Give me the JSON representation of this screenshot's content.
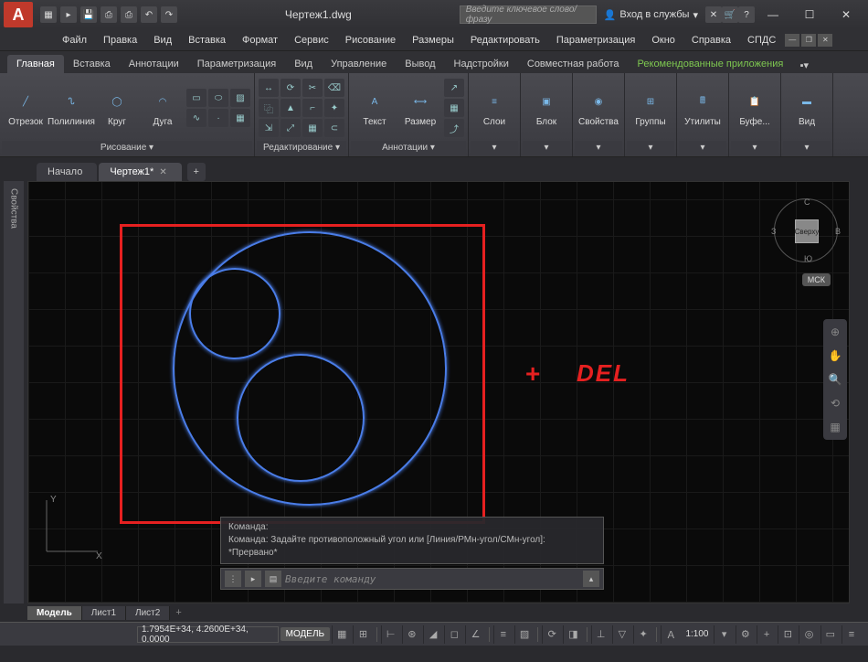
{
  "app": {
    "title": "Чертеж1.dwg",
    "logo": "A"
  },
  "search": {
    "placeholder": "Введите ключевое слово/фразу"
  },
  "signin": {
    "label": "Вход в службы"
  },
  "menu": [
    "Файл",
    "Правка",
    "Вид",
    "Вставка",
    "Формат",
    "Сервис",
    "Рисование",
    "Размеры",
    "Редактировать",
    "Параметризация",
    "Окно",
    "Справка",
    "СПДС"
  ],
  "ribbon_tabs": [
    "Главная",
    "Вставка",
    "Аннотации",
    "Параметризация",
    "Вид",
    "Управление",
    "Вывод",
    "Надстройки",
    "Совместная работа",
    "Рекомендованные приложения"
  ],
  "ribbon": {
    "draw": {
      "title": "Рисование ▾",
      "line": "Отрезок",
      "polyline": "Полилиния",
      "circle": "Круг",
      "arc": "Дуга"
    },
    "modify": {
      "title": "Редактирование ▾"
    },
    "annot": {
      "title": "Аннотации ▾",
      "text": "Текст",
      "dim": "Размер"
    },
    "layers": {
      "title": "Слои"
    },
    "block": {
      "title": "Блок"
    },
    "props": {
      "title": "Свойства"
    },
    "groups": {
      "title": "Группы"
    },
    "util": {
      "title": "Утилиты"
    },
    "clip": {
      "title": "Буфе..."
    },
    "view": {
      "title": "Вид"
    }
  },
  "file_tabs": {
    "start": "Начало",
    "active": "Чертеж1*"
  },
  "viewcube": {
    "top": "Сверху",
    "n": "С",
    "e": "В",
    "s": "Ю",
    "w": "З",
    "wcs": "МСК"
  },
  "overlay": {
    "plus": "+",
    "del": "DEL"
  },
  "ucs": {
    "y": "Y",
    "x": "X"
  },
  "cmd": {
    "hist1": "Команда:",
    "hist2": "Команда: Задайте противоположный угол или [Линия/РМн-угол/СМн-угол]: *Прервано*",
    "placeholder": "Введите команду"
  },
  "side": {
    "props": "Свойства"
  },
  "layout": {
    "model": "Модель",
    "l1": "Лист1",
    "l2": "Лист2"
  },
  "status": {
    "coords": "1.7954E+34, 4.2600E+34, 0.0000",
    "model": "МОДЕЛЬ",
    "scale": "1:100"
  }
}
